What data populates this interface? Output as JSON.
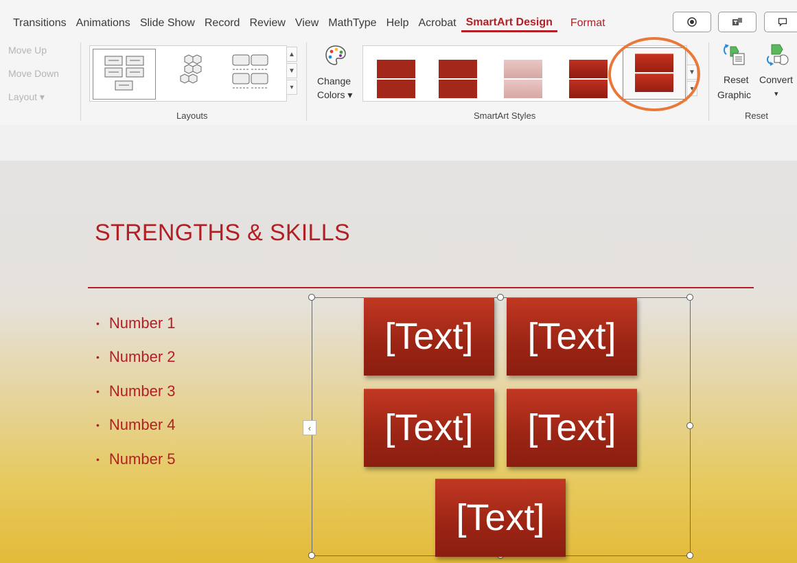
{
  "tabs": [
    "Transitions",
    "Animations",
    "Slide Show",
    "Record",
    "Review",
    "View",
    "MathType",
    "Help",
    "Acrobat"
  ],
  "active_tab": "SmartArt Design",
  "format_tab": "Format",
  "ribbon": {
    "create_graphic": {
      "move_up": "Move Up",
      "move_down": "Move Down",
      "layout": "Layout ▾"
    },
    "layouts_label": "Layouts",
    "change_colors_line1": "Change",
    "change_colors_line2": "Colors ▾",
    "smartart_styles_label": "SmartArt Styles",
    "reset_graphic_line1": "Reset",
    "reset_graphic_line2": "Graphic",
    "convert_label": "Convert",
    "convert_arrow": "▾",
    "reset_label": "Reset"
  },
  "slide": {
    "title": "STRENGTHS & SKILLS",
    "bullets": [
      "Number 1",
      "Number 2",
      "Number 3",
      "Number 4",
      "Number 5"
    ],
    "smartart_texts": [
      "[Text]",
      "[Text]",
      "[Text]",
      "[Text]",
      "[Text]"
    ]
  },
  "colors": {
    "accent": "#b41f23",
    "highlight": "#e8793a",
    "smartart_fill": "#a3281a"
  }
}
